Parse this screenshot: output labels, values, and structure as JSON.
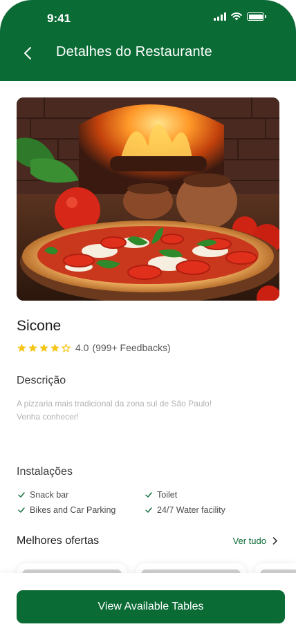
{
  "status_bar": {
    "time": "9:41"
  },
  "header": {
    "title": "Detalhes do Restaurante",
    "back_icon": "chevron-left-icon"
  },
  "restaurant": {
    "name": "Sicone",
    "rating_value": "4.0",
    "rating_count": "(999+ Feedbacks)",
    "stars_filled": 4,
    "stars_total": 5
  },
  "description": {
    "title": "Descrição",
    "line1": "A pizzaria mais tradicional da zona sul de São Paulo!",
    "line2": "Venha conhecer!"
  },
  "facilities": {
    "title": "Instalações",
    "items": [
      "Snack bar",
      "Toilet",
      "Bikes and Car Parking",
      "24/7 Water facility"
    ]
  },
  "offers": {
    "title": "Melhores ofertas",
    "see_all": "Ver tudo"
  },
  "cta": {
    "label": "View Available Tables"
  },
  "colors": {
    "brand_green": "#0a6b35",
    "star_yellow": "#f5c518"
  }
}
